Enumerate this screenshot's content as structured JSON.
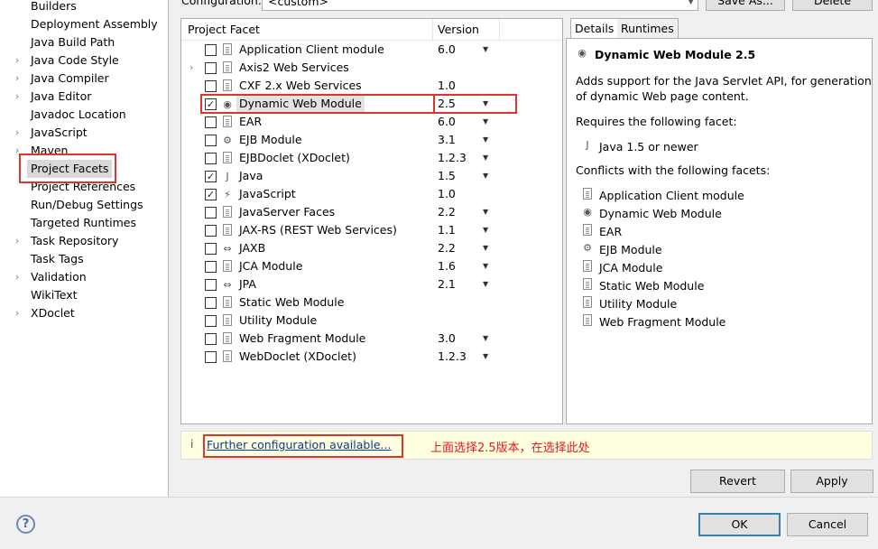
{
  "nav": {
    "items": [
      {
        "label": "Builders",
        "arrow": ""
      },
      {
        "label": "Deployment Assembly",
        "arrow": ""
      },
      {
        "label": "Java Build Path",
        "arrow": ""
      },
      {
        "label": "Java Code Style",
        "arrow": "›"
      },
      {
        "label": "Java Compiler",
        "arrow": "›"
      },
      {
        "label": "Java Editor",
        "arrow": "›"
      },
      {
        "label": "Javadoc Location",
        "arrow": ""
      },
      {
        "label": "JavaScript",
        "arrow": "›"
      },
      {
        "label": "Maven",
        "arrow": "›"
      },
      {
        "label": "Project Facets",
        "arrow": ""
      },
      {
        "label": "Project References",
        "arrow": ""
      },
      {
        "label": "Run/Debug Settings",
        "arrow": ""
      },
      {
        "label": "Targeted Runtimes",
        "arrow": ""
      },
      {
        "label": "Task Repository",
        "arrow": "›"
      },
      {
        "label": "Task Tags",
        "arrow": ""
      },
      {
        "label": "Validation",
        "arrow": "›"
      },
      {
        "label": "WikiText",
        "arrow": ""
      },
      {
        "label": "XDoclet",
        "arrow": "›"
      }
    ]
  },
  "config": {
    "label": "Configuration:",
    "value": "<custom>",
    "save_as": "Save As...",
    "delete": "Delete"
  },
  "facets": {
    "header_name": "Project Facet",
    "header_version": "Version",
    "rows": [
      {
        "name": "Application Client module",
        "version": "6.0",
        "checked": false,
        "dropdown": true,
        "expander": false,
        "icon": "document-icon"
      },
      {
        "name": "Axis2 Web Services",
        "version": "",
        "checked": false,
        "dropdown": false,
        "expander": true,
        "icon": "document-icon"
      },
      {
        "name": "CXF 2.x Web Services",
        "version": "1.0",
        "checked": false,
        "dropdown": false,
        "expander": false,
        "icon": "document-icon"
      },
      {
        "name": "Dynamic Web Module",
        "version": "2.5",
        "checked": true,
        "dropdown": true,
        "expander": false,
        "icon": "web-module-icon"
      },
      {
        "name": "EAR",
        "version": "6.0",
        "checked": false,
        "dropdown": true,
        "expander": false,
        "icon": "document-icon"
      },
      {
        "name": "EJB Module",
        "version": "3.1",
        "checked": false,
        "dropdown": true,
        "expander": false,
        "icon": "ejb-icon"
      },
      {
        "name": "EJBDoclet (XDoclet)",
        "version": "1.2.3",
        "checked": false,
        "dropdown": true,
        "expander": false,
        "icon": "document-icon"
      },
      {
        "name": "Java",
        "version": "1.5",
        "checked": true,
        "dropdown": true,
        "expander": false,
        "icon": "java-icon"
      },
      {
        "name": "JavaScript",
        "version": "1.0",
        "checked": true,
        "dropdown": false,
        "expander": false,
        "icon": "javascript-icon"
      },
      {
        "name": "JavaServer Faces",
        "version": "2.2",
        "checked": false,
        "dropdown": true,
        "expander": false,
        "icon": "document-icon"
      },
      {
        "name": "JAX-RS (REST Web Services)",
        "version": "1.1",
        "checked": false,
        "dropdown": true,
        "expander": false,
        "icon": "document-icon"
      },
      {
        "name": "JAXB",
        "version": "2.2",
        "checked": false,
        "dropdown": true,
        "expander": false,
        "icon": "jaxb-icon"
      },
      {
        "name": "JCA Module",
        "version": "1.6",
        "checked": false,
        "dropdown": true,
        "expander": false,
        "icon": "document-icon"
      },
      {
        "name": "JPA",
        "version": "2.1",
        "checked": false,
        "dropdown": true,
        "expander": false,
        "icon": "jpa-icon"
      },
      {
        "name": "Static Web Module",
        "version": "",
        "checked": false,
        "dropdown": false,
        "expander": false,
        "icon": "document-icon"
      },
      {
        "name": "Utility Module",
        "version": "",
        "checked": false,
        "dropdown": false,
        "expander": false,
        "icon": "document-icon"
      },
      {
        "name": "Web Fragment Module",
        "version": "3.0",
        "checked": false,
        "dropdown": true,
        "expander": false,
        "icon": "document-icon"
      },
      {
        "name": "WebDoclet (XDoclet)",
        "version": "1.2.3",
        "checked": false,
        "dropdown": true,
        "expander": false,
        "icon": "document-icon"
      }
    ]
  },
  "details": {
    "tab_details": "Details",
    "tab_runtimes": "Runtimes",
    "title": "Dynamic Web Module 2.5",
    "desc_line1": "Adds support for the Java Servlet API, for generation",
    "desc_line2": "of dynamic Web page content.",
    "requires_label": "Requires the following facet:",
    "requires": [
      "Java 1.5 or newer"
    ],
    "conflicts_label": "Conflicts with the following facets:",
    "conflicts": [
      "Application Client module",
      "Dynamic Web Module",
      "EAR",
      "EJB Module",
      "JCA Module",
      "Static Web Module",
      "Utility Module",
      "Web Fragment Module"
    ]
  },
  "infobar": {
    "icon": "i",
    "link": "Further configuration available...",
    "note": "上面选择2.5版本，在选择此处"
  },
  "buttons": {
    "revert": "Revert",
    "apply": "Apply",
    "ok": "OK",
    "cancel": "Cancel",
    "help": "?"
  },
  "colors": {
    "annotation_red": "#e0322f",
    "link_blue": "#0a3a8e",
    "info_bg": "#ffffe1"
  }
}
